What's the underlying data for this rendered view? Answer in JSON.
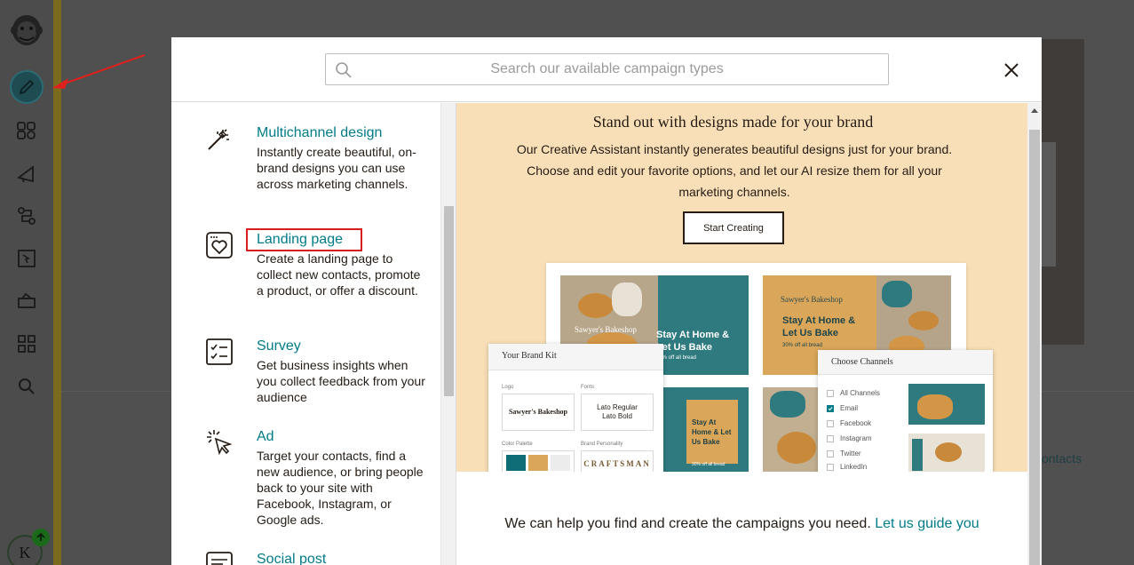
{
  "search": {
    "placeholder": "Search our available campaign types"
  },
  "campaigns": [
    {
      "title": "Multichannel design",
      "desc": "Instantly create beautiful, on-brand designs you can use across marketing channels.",
      "icon": "magic-wand-icon"
    },
    {
      "title": "Landing page",
      "desc": "Create a landing page to collect new contacts, promote a product, or offer a discount.",
      "icon": "landing-page-heart-icon"
    },
    {
      "title": "Survey",
      "desc": "Get business insights when you collect feedback from your audience",
      "icon": "checklist-icon"
    },
    {
      "title": "Ad",
      "desc": "Target your contacts, find a new audience, or bring people back to your site with Facebook, Instagram, or Google ads.",
      "icon": "cursor-click-icon"
    },
    {
      "title": "Social post",
      "desc": "",
      "icon": "social-post-icon"
    }
  ],
  "promo": {
    "title": "Stand out with designs made for your brand",
    "body": "Our Creative Assistant instantly generates beautiful designs just for your brand. Choose and edit your favorite options, and let our AI resize them for all your marketing channels.",
    "button": "Start Creating",
    "mock": {
      "shop_name": "Sawyer's Bakeshop",
      "headline1": "Stay At Home &",
      "headline2": "Let Us Bake",
      "offer": "30% off all bread",
      "tall_headline": "Stay At Home & Let Us Bake",
      "brand_kit": {
        "title": "Your Brand Kit",
        "logo_label": "Logo",
        "fonts_label": "Fonts",
        "logo_text": "Sawyer's Bakeshop",
        "font_regular": "Lato Regular",
        "font_bold": "Lato Bold",
        "palette_label": "Color Palette",
        "personality_label": "Brand Personality",
        "personality_value": "CRAFTSMAN"
      },
      "channels": {
        "title": "Choose Channels",
        "items": [
          {
            "label": "All Channels",
            "checked": false
          },
          {
            "label": "Email",
            "checked": true
          },
          {
            "label": "Facebook",
            "checked": false
          },
          {
            "label": "Instagram",
            "checked": false
          },
          {
            "label": "Twitter",
            "checked": false
          },
          {
            "label": "LinkedIn",
            "checked": false
          }
        ]
      }
    }
  },
  "guide": {
    "text": "We can help you find and create the campaigns you need.",
    "link": "Let us guide you"
  },
  "background": {
    "contacts_fragment": "ontacts"
  },
  "nav": {
    "avatar_letter": "K"
  },
  "colors": {
    "teal": "#007c89",
    "peach": "#f9dfb7",
    "highlight_red": "#d81d1d",
    "text": "#241c15"
  }
}
